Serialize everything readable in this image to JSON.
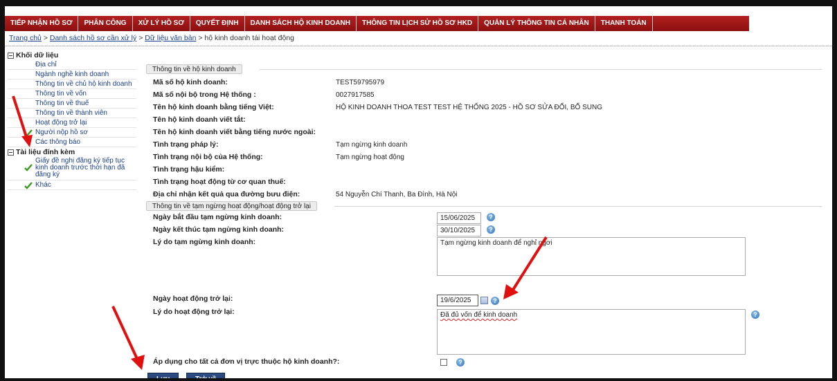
{
  "nav": {
    "items": [
      "TIẾP NHẬN HỒ SƠ",
      "PHÂN CÔNG",
      "XỬ LÝ HỒ SƠ",
      "QUYẾT ĐỊNH",
      "DANH SÁCH HỘ KINH DOANH",
      "THÔNG TIN LỊCH SỬ HỒ SƠ HKD",
      "QUẢN LÝ THÔNG TIN CÁ NHÂN",
      "THANH TOÁN"
    ]
  },
  "breadcrumb": {
    "home": "Trang chủ",
    "sep": ">",
    "list": "Danh sách hồ sơ cần xử lý",
    "data": "Dữ liệu văn bản",
    "current": "hộ kinh doanh tái hoạt động"
  },
  "sidebar": {
    "group1": "Khối dữ liệu",
    "items": [
      "Địa chỉ",
      "Ngành nghề kinh doanh",
      "Thông tin về chủ hộ kinh doanh",
      "Thông tin về vốn",
      "Thông tin về thuế",
      "Thông tin về thành viên",
      "Hoạt động trở lại",
      "Người nộp hồ sơ",
      "Các thông báo"
    ],
    "group2": "Tài liệu đính kèm",
    "attachments": [
      "Giấy đề nghị đăng ký tiếp tục kinh doanh trước thời hạn đã đăng ký",
      "Khác"
    ]
  },
  "section1": {
    "title": "Thông tin về hộ kinh doanh",
    "rows": [
      {
        "label": "Mã số hộ kinh doanh:",
        "value": "TEST59795979"
      },
      {
        "label": "Mã số nội bộ trong Hệ thống :",
        "value": "0027917585"
      },
      {
        "label": "Tên hộ kinh doanh bằng tiếng Việt:",
        "value": "HỘ KINH DOANH THOA TEST TEST HỆ THỐNG 2025 - HỒ SƠ SỬA ĐỔI, BỔ SUNG"
      },
      {
        "label": "Tên hộ kinh doanh viết tắt:",
        "value": ""
      },
      {
        "label": "Tên hộ kinh doanh viết bằng tiếng nước ngoài:",
        "value": ""
      },
      {
        "label": "Tình trạng pháp lý:",
        "value": "Tạm ngừng kinh doanh"
      },
      {
        "label": "Tình trạng nội bộ của Hệ thống:",
        "value": "Tạm ngừng hoạt động"
      },
      {
        "label": "Tình trạng hậu kiểm:",
        "value": ""
      },
      {
        "label": "Tình trạng hoạt động từ cơ quan thuế:",
        "value": ""
      },
      {
        "label": "Địa chỉ nhận kết quả qua đường bưu điện:",
        "value": "54 Nguyễn Chí Thanh, Ba Đình, Hà Nội"
      }
    ]
  },
  "section2": {
    "title": "Thông tin về tạm ngừng hoạt động/hoạt động trở lại",
    "start_label": "Ngày bắt đầu tạm ngừng kinh doanh:",
    "start_value": "15/06/2025",
    "end_label": "Ngày kết thúc tạm ngừng kinh doanh:",
    "end_value": "30/10/2025",
    "reason_label": "Lý do tạm ngừng kinh doanh:",
    "reason_value": "Tạm ngừng kinh doanh để nghỉ ngơi",
    "resume_label": "Ngày hoạt động trở lại:",
    "resume_value": "19/6/2025",
    "resume_reason_label": "Lý do hoạt động trở lại:",
    "resume_reason_value": "Đã đủ vốn để kinh doanh",
    "apply_all_label": "Áp dụng cho tất cả đơn vị trực thuộc hộ kinh doanh?:"
  },
  "buttons": {
    "save": "Lưu",
    "back": "Trở về"
  },
  "icons": {
    "help": "?"
  }
}
